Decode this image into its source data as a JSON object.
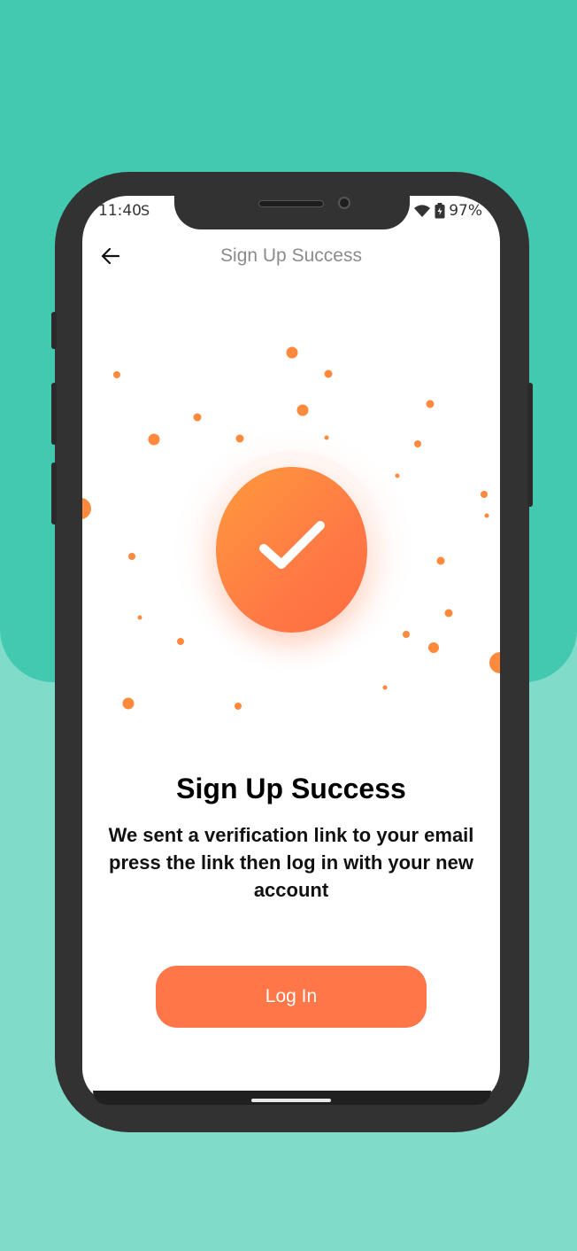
{
  "status_bar": {
    "time": "11:40",
    "carrier_icon": "S",
    "battery": "97%"
  },
  "appbar": {
    "title": "Sign Up Success"
  },
  "content": {
    "headline": "Sign Up Success",
    "message": "We sent a verification link to your email press the link then log in with your new account"
  },
  "actions": {
    "login_label": "Log In"
  },
  "colors": {
    "accent": "#ff7748",
    "background_teal": "#42c9b0",
    "background_light_teal": "#80dbc9"
  }
}
